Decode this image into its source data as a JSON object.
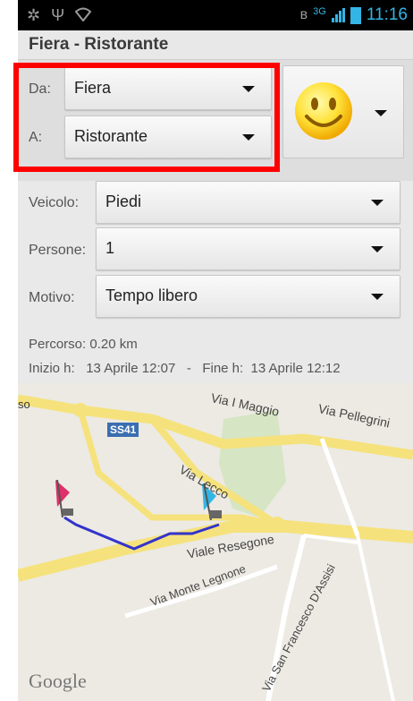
{
  "status_bar": {
    "left_icons": [
      "usb-debug-icon",
      "usb-icon",
      "wifi-icon"
    ],
    "right_icons": [
      "bluetooth-icon",
      "signal-icon",
      "battery-icon"
    ],
    "network": "3G",
    "time": "11:16"
  },
  "title": "Fiera - Ristorante",
  "route": {
    "from_label": "Da:",
    "from_value": "Fiera",
    "to_label": "A:",
    "to_value": "Ristorante"
  },
  "mood": {
    "icon": "smiley-icon"
  },
  "form": {
    "vehicle_label": "Veicolo:",
    "vehicle_value": "Piedi",
    "people_label": "Persone:",
    "people_value": "1",
    "reason_label": "Motivo:",
    "reason_value": "Tempo libero"
  },
  "trip": {
    "distance_label": "Percorso:",
    "distance_value": "0.20 km",
    "start_label": "Inizio h:",
    "start_value": "13 Aprile 12:07",
    "separator": "-",
    "end_label": "Fine h:",
    "end_value": "13 Aprile 12:12"
  },
  "map": {
    "road_badge": "SS41",
    "streets": [
      "Via I Maggio",
      "Via Pellegrini",
      "Via Lecco",
      "Viale Resegone",
      "Via Monte Legnone",
      "Via San Francesco D'Assisi"
    ],
    "edge_text": "so",
    "attribution": "Google",
    "route_color": "#3333cc",
    "start_flag_color": "#e0306a",
    "end_flag_color": "#33b5e5"
  }
}
